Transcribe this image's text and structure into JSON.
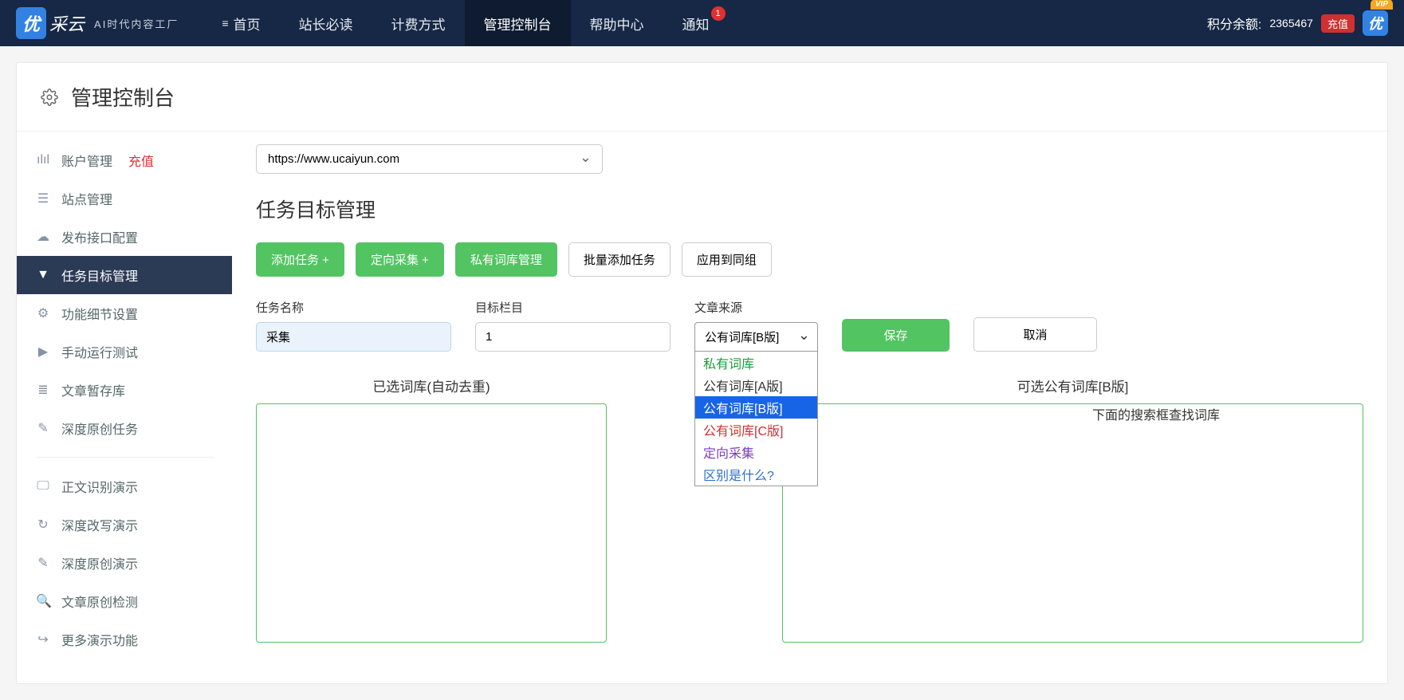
{
  "nav": {
    "logo": "优",
    "logo_cn": "采云",
    "logo_sub": "AI时代内容工厂",
    "items": [
      {
        "label": "首页",
        "icon": "≡",
        "active": false
      },
      {
        "label": "站长必读",
        "active": false
      },
      {
        "label": "计费方式",
        "active": false
      },
      {
        "label": "管理控制台",
        "active": true
      },
      {
        "label": "帮助中心",
        "active": false
      },
      {
        "label": "通知",
        "badge": "1",
        "active": false
      }
    ],
    "points_label": "积分余额:",
    "points_value": "2365467",
    "recharge": "充值",
    "avatar": "优",
    "vip": "VIP"
  },
  "page": {
    "title": "管理控制台"
  },
  "sidebar": {
    "items_a": [
      {
        "icon": "📊",
        "label": "账户管理",
        "extra": "充值"
      },
      {
        "icon": "☰",
        "label": "站点管理"
      },
      {
        "icon": "☁",
        "label": "发布接口配置"
      },
      {
        "icon": "▼",
        "label": "任务目标管理",
        "active": true
      },
      {
        "icon": "⚙",
        "label": "功能细节设置"
      },
      {
        "icon": "▶",
        "label": "手动运行测试"
      },
      {
        "icon": "≡",
        "label": "文章暂存库"
      },
      {
        "icon": "✎",
        "label": "深度原创任务"
      }
    ],
    "items_b": [
      {
        "icon": "🖵",
        "label": "正文识别演示"
      },
      {
        "icon": "↻",
        "label": "深度改写演示"
      },
      {
        "icon": "✎",
        "label": "深度原创演示"
      },
      {
        "icon": "🔍",
        "label": "文章原创检测"
      },
      {
        "icon": "↪",
        "label": "更多演示功能"
      }
    ]
  },
  "main": {
    "site_value": "https://www.ucaiyun.com",
    "section_title": "任务目标管理",
    "buttons": {
      "add_task": "添加任务 +",
      "directed": "定向采集 +",
      "private_mgr": "私有词库管理",
      "bulk_add": "批量添加任务",
      "apply_group": "应用到同组"
    },
    "form": {
      "task_name_label": "任务名称",
      "task_name_value": "采集",
      "target_col_label": "目标栏目",
      "target_col_value": "1",
      "source_label": "文章来源",
      "source_value": "公有词库[B版]",
      "source_options": [
        {
          "text": "私有词库",
          "cls": "green"
        },
        {
          "text": "公有词库[A版]",
          "cls": ""
        },
        {
          "text": "公有词库[B版]",
          "cls": "sel"
        },
        {
          "text": "公有词库[C版]",
          "cls": "red"
        },
        {
          "text": "定向采集",
          "cls": "purple"
        },
        {
          "text": "区别是什么?",
          "cls": "link"
        }
      ],
      "save": "保存",
      "cancel": "取消"
    },
    "lists": {
      "selected_title": "已选词库(自动去重)",
      "available_title": "可选公有词库[B版]",
      "search_hint": "下面的搜索框查找词库"
    }
  }
}
